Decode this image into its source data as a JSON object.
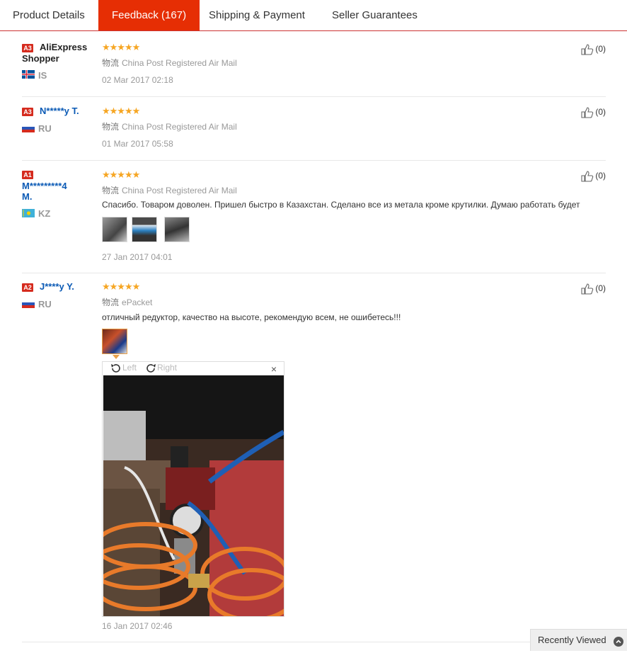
{
  "tabs": [
    {
      "label": "Product Details"
    },
    {
      "label": "Feedback (167)"
    },
    {
      "label": "Shipping & Payment"
    },
    {
      "label": "Seller Guarantees"
    }
  ],
  "reviews": [
    {
      "level": "A3",
      "name_line1": "AliExpress",
      "name_line2": "Shopper",
      "country": "IS",
      "stars": "★★★★★",
      "logistics_cn": "物流",
      "shipping": "China Post Registered Air Mail",
      "text": "",
      "date": "02 Mar 2017 02:18",
      "useful": "(0)"
    },
    {
      "level": "A3",
      "name_line1": "N*****y T.",
      "name_line2": "",
      "country": "RU",
      "stars": "★★★★★",
      "logistics_cn": "物流",
      "shipping": "China Post Registered Air Mail",
      "text": "",
      "date": "01 Mar 2017 05:58",
      "useful": "(0)"
    },
    {
      "level": "A1",
      "name_line1": "M*********4",
      "name_line2": "M.",
      "country": "KZ",
      "stars": "★★★★★",
      "logistics_cn": "物流",
      "shipping": "China Post Registered Air Mail",
      "text": "Спасибо. Товаром доволен. Пришел быстро в Казахстан. Сделано все из метала кроме крутилки. Думаю работать будет",
      "date": "27 Jan 2017 04:01",
      "useful": "(0)"
    },
    {
      "level": "A2",
      "name_line1": "J****y Y.",
      "name_line2": "",
      "country": "RU",
      "stars": "★★★★★",
      "logistics_cn": "物流",
      "shipping": "ePacket",
      "text": "отличный редуктор, качество на высоте, рекомендую всем, не ошибетесь!!!",
      "date": "16 Jan 2017 02:46",
      "useful": "(0)"
    }
  ],
  "viewer": {
    "left_label": "Left",
    "right_label": "Right",
    "close_label": "×"
  },
  "recently_viewed": {
    "label": "Recently Viewed"
  },
  "colors": {
    "accent": "#e62e04",
    "badge": "#d52b1e",
    "link": "#0b5ab5",
    "star": "#f6a623"
  }
}
